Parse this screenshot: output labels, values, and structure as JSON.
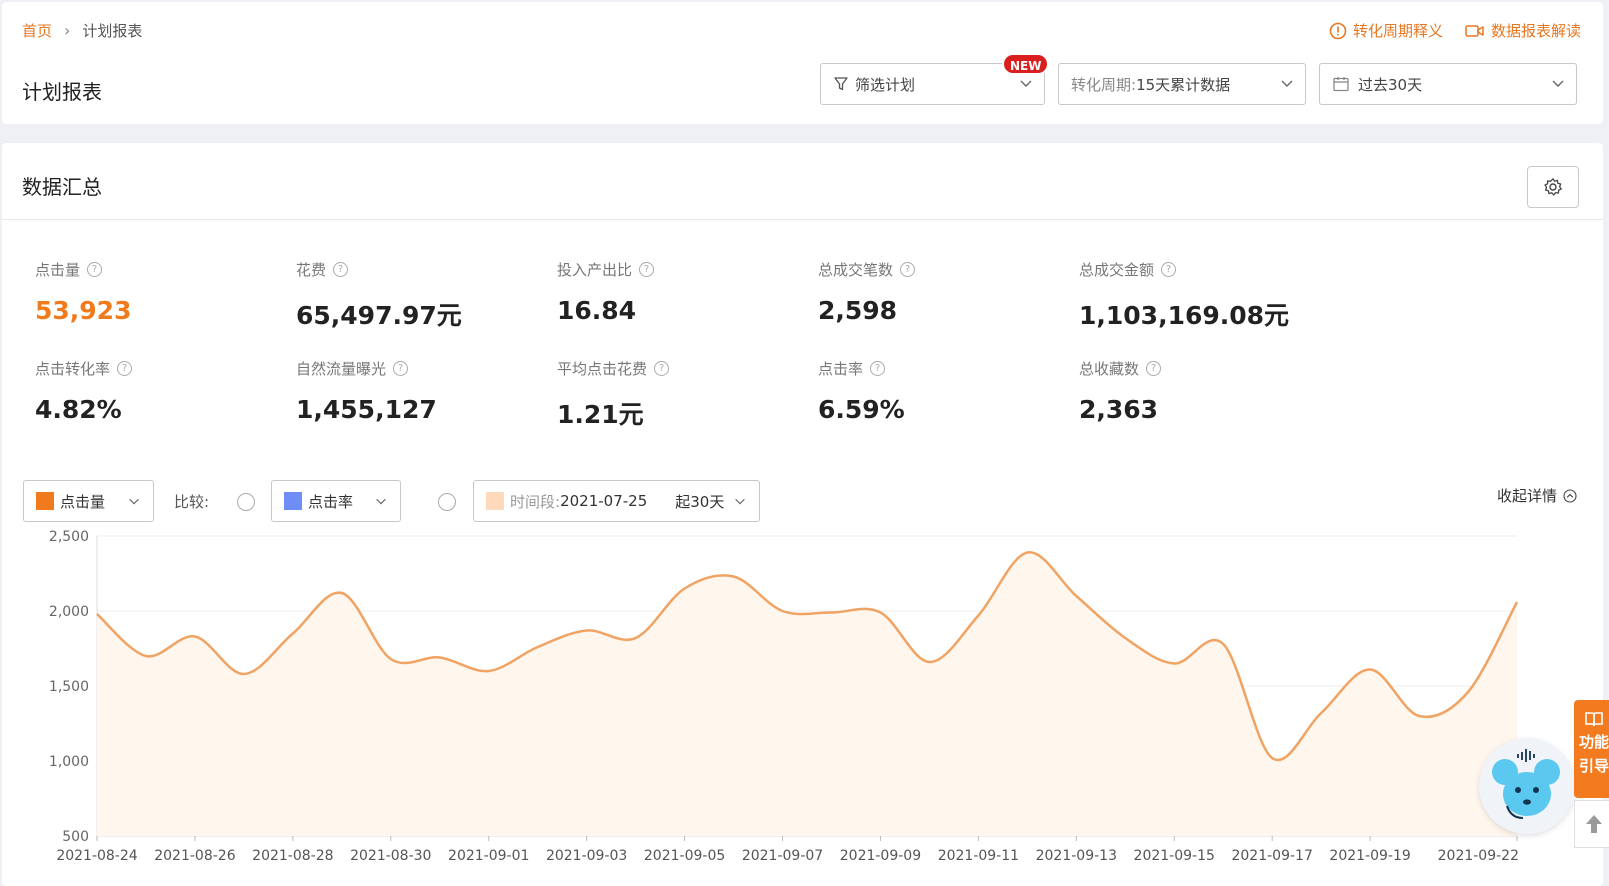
{
  "breadcrumb": {
    "home": "首页",
    "sep": "›",
    "current": "计划报表"
  },
  "top_links": [
    {
      "label": "转化周期释义",
      "icon": "alert-circle-icon"
    },
    {
      "label": "数据报表解读",
      "icon": "video-icon"
    }
  ],
  "page_title": "计划报表",
  "filters": {
    "plan_filter": "筛选计划",
    "new_badge": "NEW",
    "period_prefix": "转化周期:",
    "period_value": "15天累计数据",
    "date_range": "过去30天"
  },
  "summary": {
    "title": "数据汇总",
    "metrics_row1": [
      {
        "label": "点击量",
        "value": "53,923"
      },
      {
        "label": "花费",
        "value": "65,497.97元"
      },
      {
        "label": "投入产出比",
        "value": "16.84"
      },
      {
        "label": "总成交笔数",
        "value": "2,598"
      },
      {
        "label": "总成交金额",
        "value": "1,103,169.08元"
      }
    ],
    "metrics_row2": [
      {
        "label": "点击转化率",
        "value": "4.82%"
      },
      {
        "label": "自然流量曝光",
        "value": "1,455,127"
      },
      {
        "label": "平均点击花费",
        "value": "1.21元"
      },
      {
        "label": "点击率",
        "value": "6.59%"
      },
      {
        "label": "总收藏数",
        "value": "2,363"
      }
    ]
  },
  "chart_controls": {
    "metric1": "点击量",
    "metric1_color": "#f07b1d",
    "compare_label": "比较:",
    "metric2": "点击率",
    "metric2_color": "#6f8ef5",
    "period_prefix": "时间段:",
    "period_start": "2021-07-25",
    "period_length": "起30天",
    "period_color": "#ffd9bb",
    "collapse": "收起详情"
  },
  "side": {
    "guide_line1": "功能",
    "guide_line2": "引导"
  },
  "chart_data": {
    "type": "area",
    "series": [
      {
        "name": "点击量",
        "color": "#f0a363"
      }
    ],
    "x": [
      "2021-08-24",
      "2021-08-25",
      "2021-08-26",
      "2021-08-27",
      "2021-08-28",
      "2021-08-29",
      "2021-08-30",
      "2021-08-31",
      "2021-09-01",
      "2021-09-02",
      "2021-09-03",
      "2021-09-04",
      "2021-09-05",
      "2021-09-06",
      "2021-09-07",
      "2021-09-08",
      "2021-09-09",
      "2021-09-10",
      "2021-09-11",
      "2021-09-12",
      "2021-09-13",
      "2021-09-14",
      "2021-09-15",
      "2021-09-16",
      "2021-09-17",
      "2021-09-18",
      "2021-09-19",
      "2021-09-20",
      "2021-09-21",
      "2021-09-22"
    ],
    "values": [
      1980,
      1700,
      1830,
      1580,
      1850,
      2120,
      1680,
      1690,
      1600,
      1760,
      1870,
      1820,
      2150,
      2230,
      2000,
      1990,
      1990,
      1660,
      1970,
      2390,
      2100,
      1820,
      1650,
      1780,
      1020,
      1320,
      1610,
      1300,
      1460,
      2060
    ],
    "x_tick_labels": [
      "2021-08-24",
      "2021-08-26",
      "2021-08-28",
      "2021-08-30",
      "2021-09-01",
      "2021-09-03",
      "2021-09-05",
      "2021-09-07",
      "2021-09-09",
      "2021-09-11",
      "2021-09-13",
      "2021-09-15",
      "2021-09-17",
      "2021-09-19",
      "2021-09-22"
    ],
    "y_ticks": [
      "500",
      "1,000",
      "1,500",
      "2,000",
      "2,500"
    ],
    "ylim": [
      500,
      2500
    ],
    "grid": true
  }
}
